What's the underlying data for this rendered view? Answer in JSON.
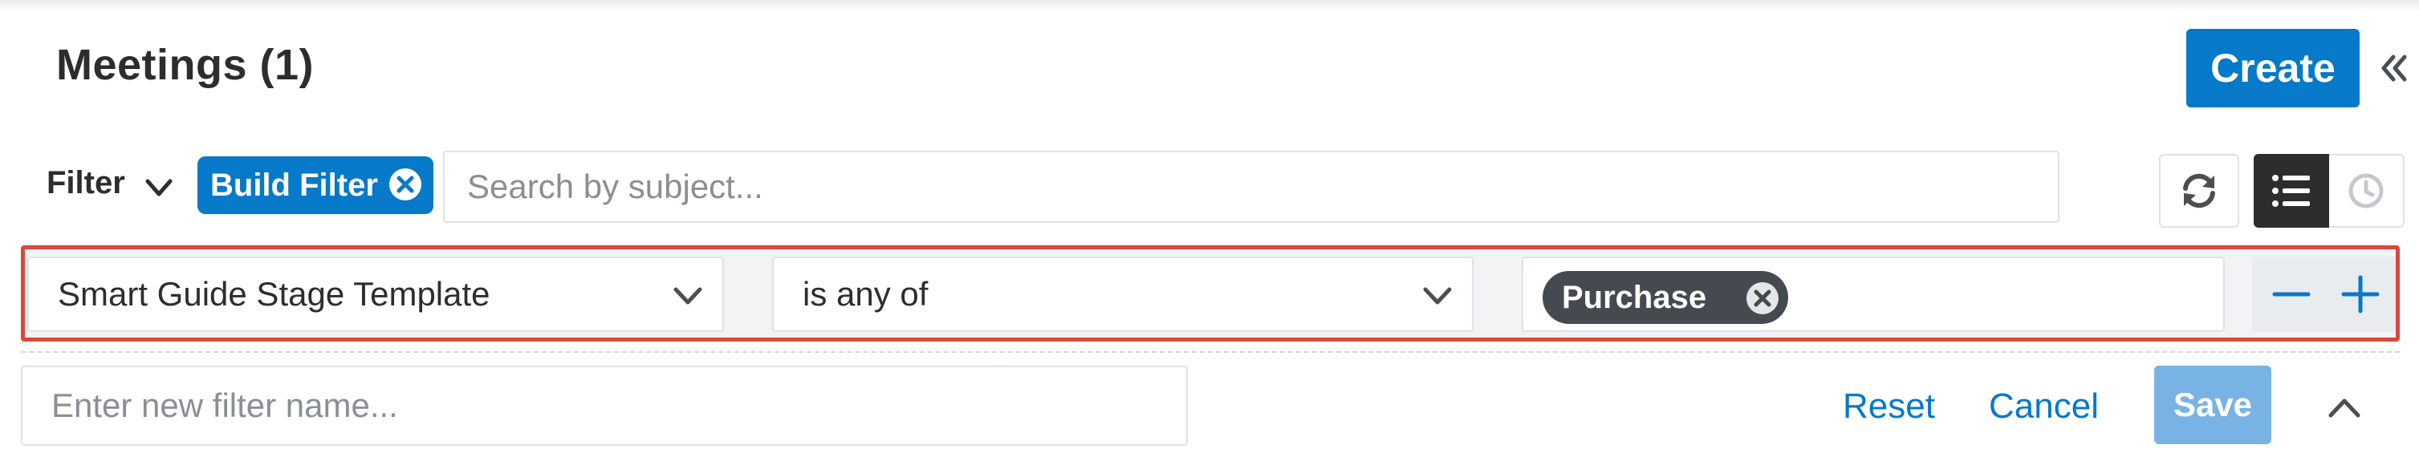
{
  "header": {
    "title": "Meetings (1)",
    "create_label": "Create",
    "collapse_icon": "double-chevron-left-icon"
  },
  "filter_bar": {
    "filter_label": "Filter",
    "build_filter_label": "Build Filter",
    "search_placeholder": "Search by subject...",
    "refresh_icon": "refresh-icon",
    "view_list_icon": "list-view-icon",
    "view_timeline_icon": "clock-icon"
  },
  "filter_row": {
    "field_value": "Smart Guide Stage Template",
    "operator_value": "is any of",
    "value_tags": [
      "Purchase"
    ],
    "highlight_color": "#d9483b"
  },
  "footer": {
    "name_placeholder": "Enter new filter name...",
    "reset_label": "Reset",
    "cancel_label": "Cancel",
    "save_label": "Save"
  },
  "colors": {
    "accent": "#0679c8",
    "save_disabled": "#79b3e5",
    "dark": "#2b2d2f"
  }
}
